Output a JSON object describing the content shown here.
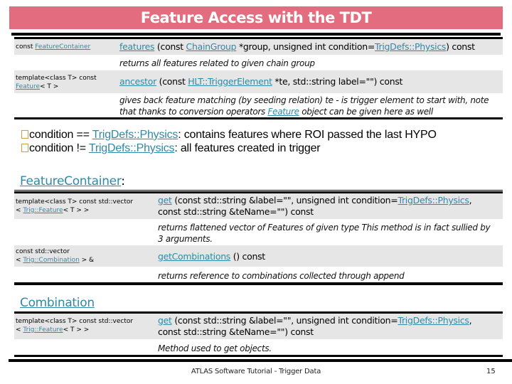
{
  "slide": {
    "title": "Feature Access with the TDT",
    "title_color": "#e36c7e",
    "link_color": "#2e8aa6"
  },
  "tdt_table": {
    "rows": [
      {
        "return_prefix": "const ",
        "return_link": "FeatureContainer",
        "method_link": "features",
        "sig_part1": " (const ",
        "sig_link1": "ChainGroup",
        "sig_part2": " *group, unsigned int condition=",
        "sig_link2": "TrigDefs::Physics",
        "sig_part3": ") const",
        "description": "returns all features related to given chain group"
      },
      {
        "return_line1": "template<class T> const",
        "return_link": "Feature",
        "return_suffix": "< T >",
        "method_link": "ancestor",
        "sig_part1": " (const ",
        "sig_link1": "HLT::TriggerElement",
        "sig_part2": " *te, std::string label=\"\") const",
        "description_part1": "gives back feature matching (by seeding relation) te - is trigger element to start with, note that thanks to conversion operators ",
        "description_link": "Feature",
        "description_part2": " object can be given here as well"
      }
    ]
  },
  "bullets": [
    {
      "prefix": "condition == ",
      "link": "TrigDefs::Physics",
      "suffix": ": contains features where ROI passed the last HYPO"
    },
    {
      "prefix": "condition != ",
      "link": "TrigDefs::Physics",
      "suffix": ": all features created in trigger"
    }
  ],
  "feature_container": {
    "heading_link": "FeatureContainer",
    "heading_suffix": ":",
    "rows": [
      {
        "return_line1": "template<class T> const std::vector",
        "return_prefix": "< ",
        "return_link": "Trig::Feature",
        "return_suffix": "< T > >",
        "method_link": "get",
        "sig_part1": " (const std::string &label=\"\", unsigned int condition=",
        "sig_link1": "TrigDefs::Physics",
        "sig_part2": ",",
        "sig_line2": "const std::string &teName=\"\") const",
        "description": "returns flattened vector of Features of given type This method is in fact sullied by 3 arguments."
      },
      {
        "return_line1": "const std::vector",
        "return_prefix": "< ",
        "return_link": "Trig::Combination",
        "return_suffix": " > &",
        "method_link": "getCombinations",
        "sig_part1": " () const",
        "description": "returns reference to combinations collected through append"
      }
    ]
  },
  "combination": {
    "heading_link": "Combination",
    "rows": [
      {
        "return_line1": "template<class T> const std::vector",
        "return_prefix": "< ",
        "return_link": "Trig::Feature",
        "return_suffix": "< T > >",
        "method_link": "get",
        "sig_part1": " (const std::string &label=\"\", unsigned int condition=",
        "sig_link1": "TrigDefs::Physics",
        "sig_part2": ",",
        "sig_line2": "const std::string &teName=\"\") const",
        "description": "Method used to get objects."
      }
    ]
  },
  "footer": {
    "text": "ATLAS Software Tutorial - Trigger Data",
    "page_number": "15"
  }
}
